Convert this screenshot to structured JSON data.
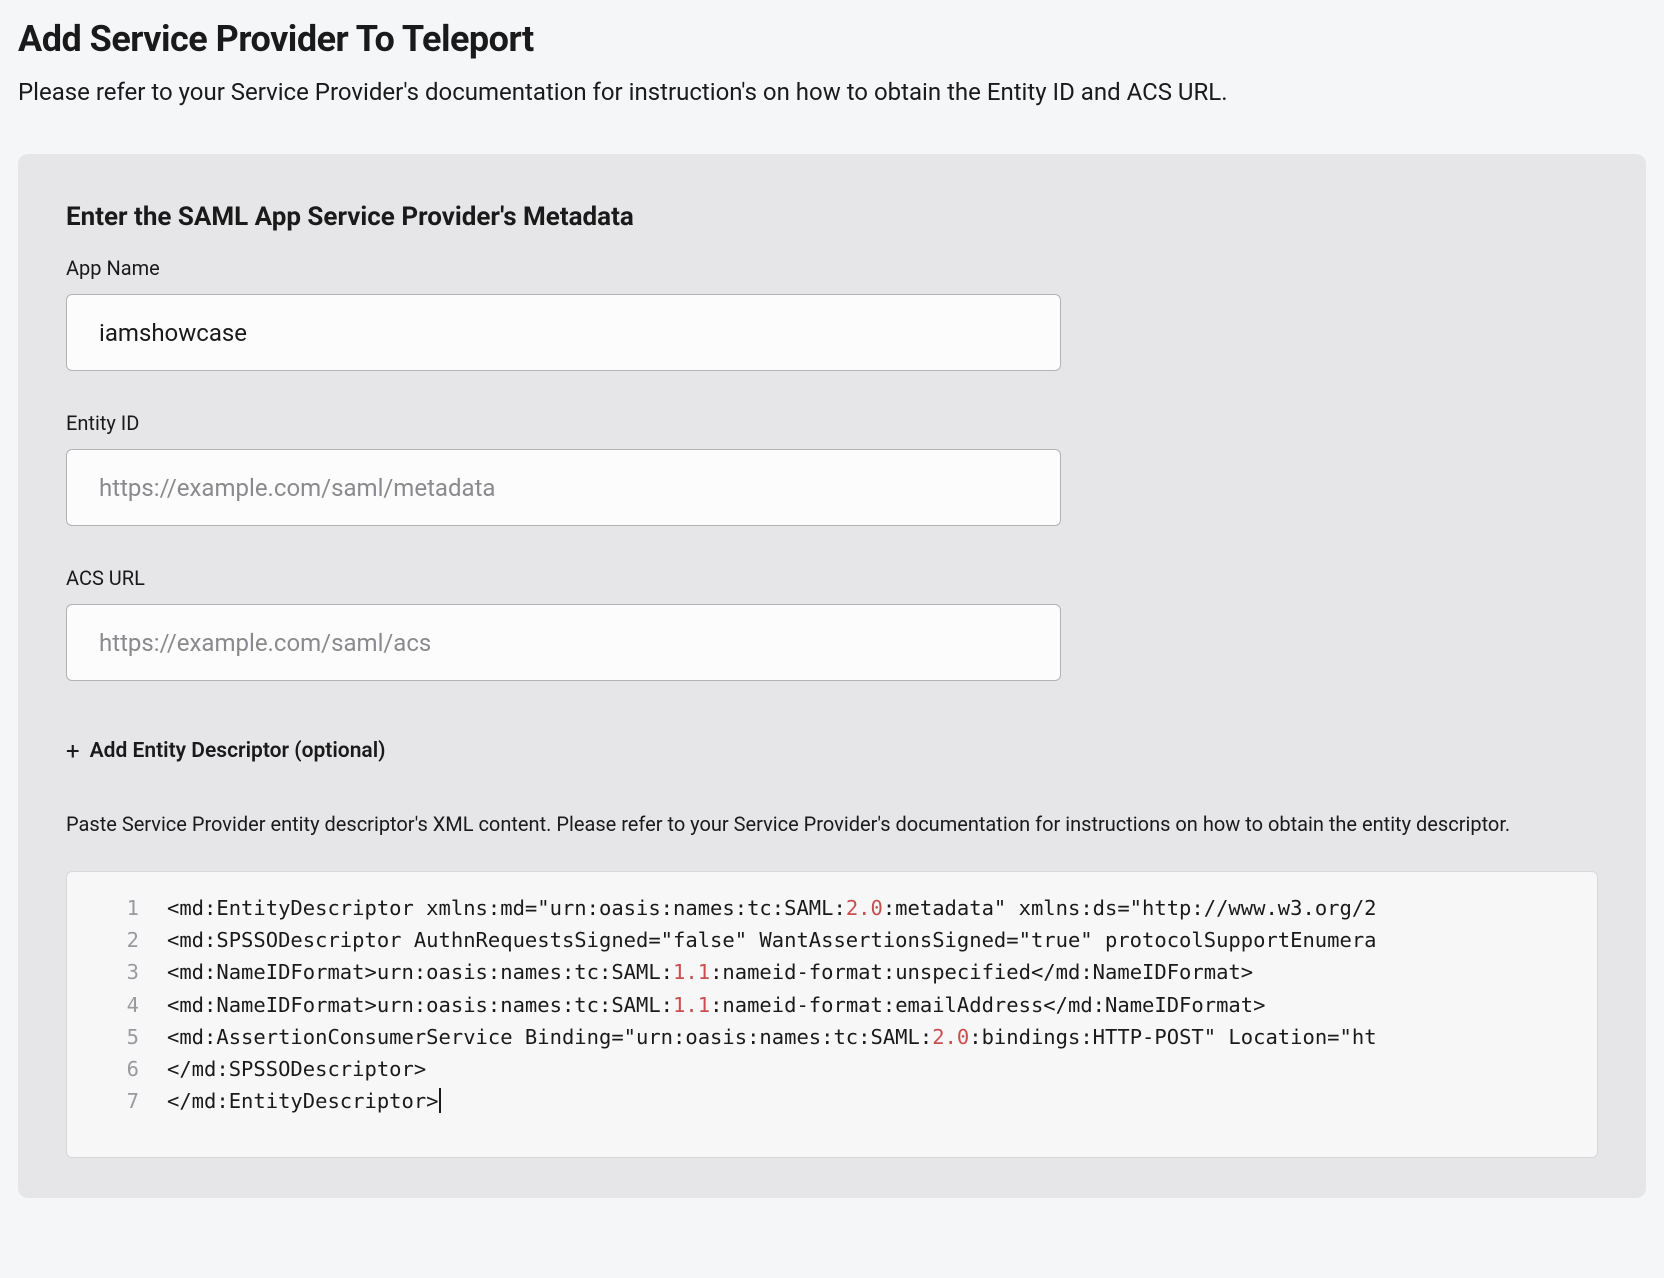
{
  "header": {
    "title": "Add Service Provider To Teleport",
    "subtitle": "Please refer to your Service Provider's documentation for instruction's on how to obtain the Entity ID and ACS URL."
  },
  "form": {
    "section_heading": "Enter the SAML App Service Provider's Metadata",
    "app_name": {
      "label": "App Name",
      "value": "iamshowcase",
      "placeholder": ""
    },
    "entity_id": {
      "label": "Entity ID",
      "value": "",
      "placeholder": "https://example.com/saml/metadata"
    },
    "acs_url": {
      "label": "ACS URL",
      "value": "",
      "placeholder": "https://example.com/saml/acs"
    },
    "add_entity": {
      "label": "Add Entity Descriptor (optional)"
    },
    "help": "Paste Service Provider entity descriptor's XML content. Please refer to your Service Provider's documentation for instructions on how to obtain the entity descriptor.",
    "xml_lines": [
      "<md:EntityDescriptor xmlns:md=\"urn:oasis:names:tc:SAML:2.0:metadata\" xmlns:ds=\"http://www.w3.org/2",
      "<md:SPSSODescriptor AuthnRequestsSigned=\"false\" WantAssertionsSigned=\"true\" protocolSupportEnumera",
      "<md:NameIDFormat>urn:oasis:names:tc:SAML:1.1:nameid-format:unspecified</md:NameIDFormat>",
      "<md:NameIDFormat>urn:oasis:names:tc:SAML:1.1:nameid-format:emailAddress</md:NameIDFormat>",
      "<md:AssertionConsumerService Binding=\"urn:oasis:names:tc:SAML:2.0:bindings:HTTP-POST\" Location=\"ht",
      "</md:SPSSODescriptor>",
      "</md:EntityDescriptor>"
    ]
  }
}
